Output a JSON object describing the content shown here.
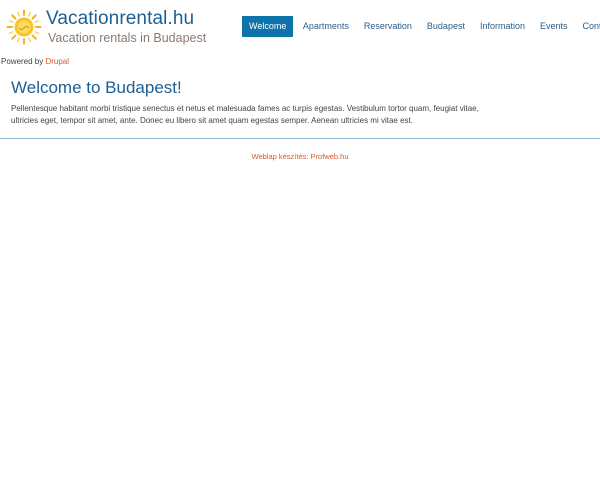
{
  "header": {
    "site_name": "Vacationrental.hu",
    "slogan": "Vacation rentals in Budapest",
    "logo_icon": "sun-icon"
  },
  "nav": {
    "items": [
      {
        "label": "Welcome",
        "active": true
      },
      {
        "label": "Apartments"
      },
      {
        "label": "Reservation"
      },
      {
        "label": "Budapest"
      },
      {
        "label": "Information"
      },
      {
        "label": "Events"
      },
      {
        "label": "Contact"
      }
    ]
  },
  "powered": {
    "prefix": "Powered by ",
    "link": "Drupal"
  },
  "main": {
    "title": "Welcome to Budapest!",
    "body": "Pellentesque habitant morbi tristique senectus et netus et malesuada fames ac turpis egestas. Vestibulum tortor quam, feugiat vitae, ultricies eget, tempor sit amet, ante. Donec eu libero sit amet quam egestas semper. Aenean ultricies mi vitae est."
  },
  "footer": {
    "credit": "Weblap készítés: Profweb.hu"
  },
  "colors": {
    "accent": "#0e72ab",
    "title": "#1d5f92",
    "link": "#d9582e",
    "divider": "#8fb8cc"
  }
}
